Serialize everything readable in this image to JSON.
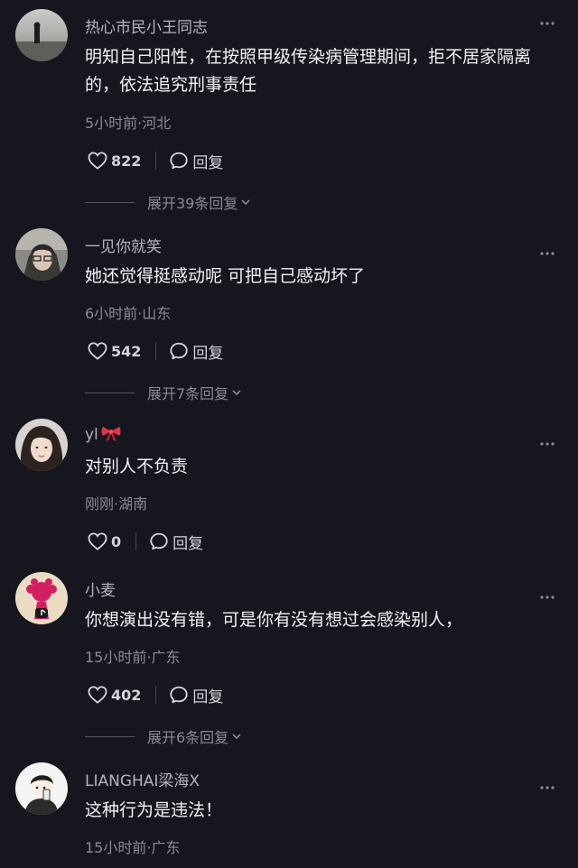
{
  "comments": [
    {
      "username": "热心市民小王同志",
      "text": "明知自己阳性，在按照甲级传染病管理期间，拒不居家隔离的，依法追究刑事责任",
      "meta": "5小时前·河北",
      "likes": "822",
      "reply_label": "回复",
      "expand_label": "展开39条回复"
    },
    {
      "username": "一见你就笑",
      "text": "她还觉得挺感动呢 可把自己感动坏了",
      "meta": "6小时前·山东",
      "likes": "542",
      "reply_label": "回复",
      "expand_label": "展开7条回复"
    },
    {
      "username": "yl",
      "text": "对别人不负责",
      "meta": "刚刚·湖南",
      "likes": "0",
      "reply_label": "回复"
    },
    {
      "username": "小麦",
      "text": "你想演出没有错，可是你有没有想过会感染别人，",
      "meta": "15小时前·广东",
      "likes": "402",
      "reply_label": "回复",
      "expand_label": "展开6条回复"
    },
    {
      "username": "LIANGHAI梁海X",
      "text": "这种行为是违法！",
      "meta": "15小时前·广东"
    }
  ],
  "icons": {
    "more": "more-horizontal-icon",
    "like": "heart-outline-icon",
    "reply": "speech-bubble-icon",
    "expand": "chevron-down-icon",
    "badge": "red-bow-icon"
  },
  "colors": {
    "background": "#16161e",
    "text": "#f2f2f4",
    "username": "#b4b4ba",
    "meta": "#8a8a92"
  }
}
